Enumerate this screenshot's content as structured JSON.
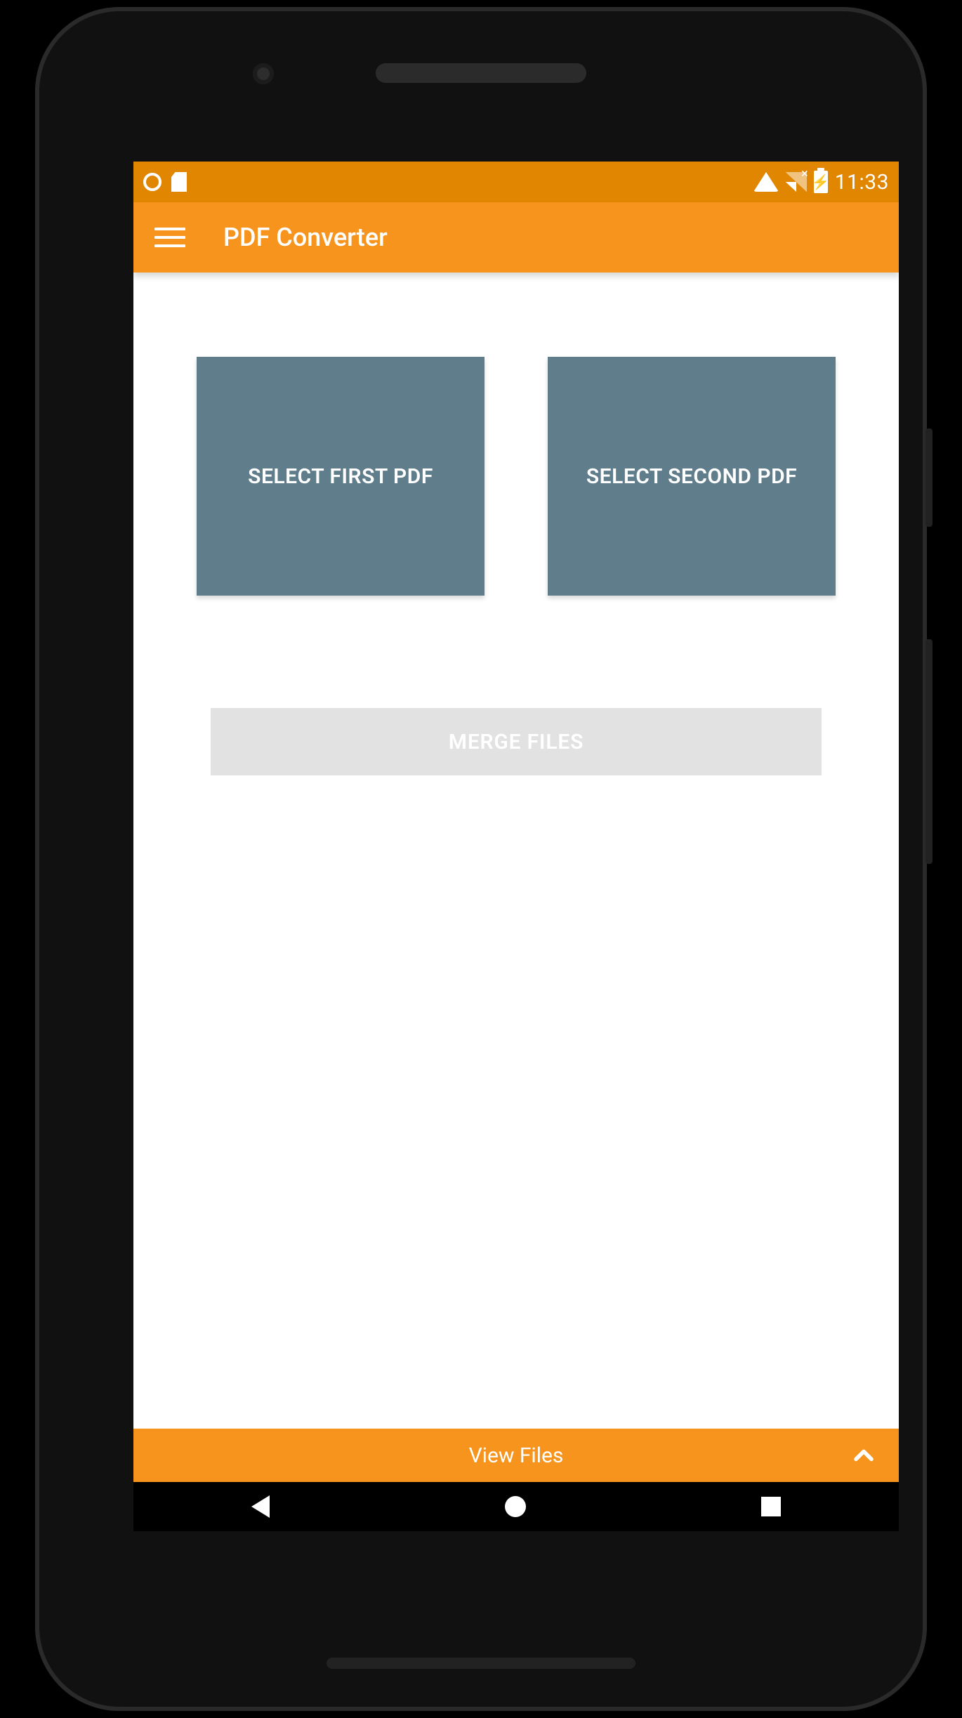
{
  "status": {
    "time": "11:33"
  },
  "app_bar": {
    "title": "PDF Converter"
  },
  "main": {
    "select_first_label": "SELECT FIRST PDF",
    "select_second_label": "SELECT SECOND PDF",
    "merge_label": "MERGE FILES"
  },
  "bottom": {
    "view_files_label": "View Files"
  }
}
